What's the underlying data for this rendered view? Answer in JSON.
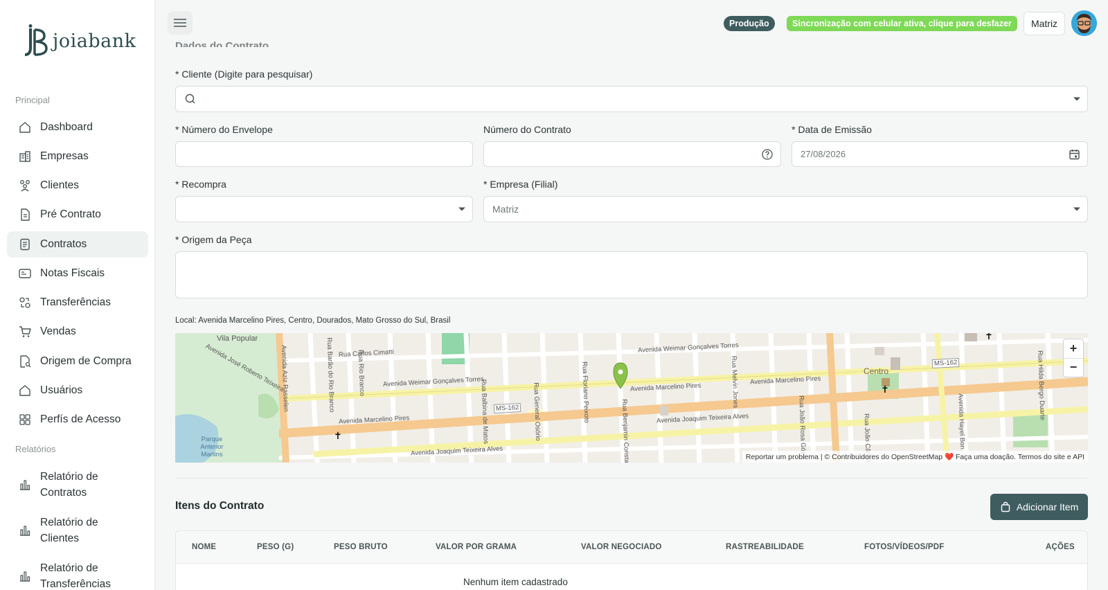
{
  "app": {
    "logo_text": "joiabank"
  },
  "sidebar": {
    "section_main": "Principal",
    "section_reports": "Relatórios",
    "items": [
      {
        "label": "Dashboard",
        "icon": "home-icon"
      },
      {
        "label": "Empresas",
        "icon": "building-icon"
      },
      {
        "label": "Clientes",
        "icon": "users-icon"
      },
      {
        "label": "Pré Contrato",
        "icon": "document-icon"
      },
      {
        "label": "Contratos",
        "icon": "contract-icon",
        "active": true
      },
      {
        "label": "Notas Fiscais",
        "icon": "receipt-icon"
      },
      {
        "label": "Transferências",
        "icon": "transfer-icon"
      },
      {
        "label": "Vendas",
        "icon": "cart-icon"
      },
      {
        "label": "Origem de Compra",
        "icon": "search-document-icon"
      },
      {
        "label": "Usuários",
        "icon": "home-icon"
      },
      {
        "label": "Perfís de Acesso",
        "icon": "grid-icon"
      }
    ],
    "reports": [
      {
        "label": "Relatório de Contratos",
        "icon": "bar-chart-icon"
      },
      {
        "label": "Relatório de Clientes",
        "icon": "bar-chart-icon"
      },
      {
        "label": "Relatório de Transferências",
        "icon": "bar-chart-icon"
      }
    ]
  },
  "header": {
    "env_badge": "Produção",
    "sync_badge": "Sincronização com celular ativa, clique para desfazer",
    "branch": "Matriz"
  },
  "form": {
    "section_title": "Dados do Contrato",
    "client_label": "* Cliente (Digite para pesquisar)",
    "client_value": "",
    "envelope_label": "* Número do Envelope",
    "envelope_value": "",
    "contract_number_label": "Número do Contrato",
    "contract_number_value": "",
    "issue_date_label": "* Data de Emissão",
    "issue_date_value": "27/08/2026",
    "repurchase_label": "* Recompra",
    "repurchase_value": "",
    "company_label": "* Empresa (Filial)",
    "company_value": "Matriz",
    "origin_label": "* Origem da Peça",
    "origin_value": "",
    "location": "Local: Avenida Marcelino Pires, Centro, Dourados, Mato Grosso do Sul, Brasil"
  },
  "map": {
    "attribution": "Reportar um problema | © Contribuidores do OpenStreetMap ❤️ Faça uma doação. Termos do site e API",
    "zoom_in": "+",
    "zoom_out": "−",
    "labels": {
      "vila_popular": "Vila Popular",
      "centro": "Centro",
      "parque": "Parque Antenor Martins",
      "weimar1": "Avenida Weimar Gonçalves Torres",
      "weimar2": "Avenida Weimar Gonçalves Torres",
      "marcelino1": "Avenida Marcelino Pires",
      "marcelino2": "Avenida Marcelino Pires",
      "marcelino3": "Avenida Marcelino Pires",
      "joaquim1": "Avenida Joaquim Teixeira Alves",
      "joaquim2": "Avenida Joaquim Teixeira Alves",
      "ms162a": "MS-162",
      "ms162b": "MS-162",
      "jose_roberto": "Avenida José Roberto Teixeira",
      "carlos": "Rua Carlos Cimatti",
      "aziz": "Avenida Aziz Rasselen",
      "rio_branco": "Rua Rio Branco",
      "barao": "Rua Barão do Rio Branco",
      "balbina": "Rua Balbina de Matos",
      "osorio": "Rua General Osório",
      "floriano": "Rua Floriano Peixoto",
      "benjamin": "Rua Benjamin Constant",
      "melvin": "Rua Melvin Jones",
      "joao_rosa": "Rua João Rosa Góes",
      "joao_candido": "Rua João Cândido",
      "hayel": "Avenida Hayel Bon",
      "hilda": "Rua Hilda Bergo Duarte"
    }
  },
  "items": {
    "title": "Itens do Contrato",
    "add_button": "Adicionar Item",
    "columns": [
      "NOME",
      "PESO (G)",
      "PESO BRUTO",
      "VALOR POR GRAMA",
      "VALOR NEGOCIADO",
      "RASTREABILIDADE",
      "FOTOS/VÍDEOS/PDF",
      "AÇÕES"
    ],
    "empty": "Nenhum item cadastrado"
  },
  "colors": {
    "primary": "#3f5c5f",
    "sync": "#7ed957",
    "marker": "#8bc34a"
  }
}
